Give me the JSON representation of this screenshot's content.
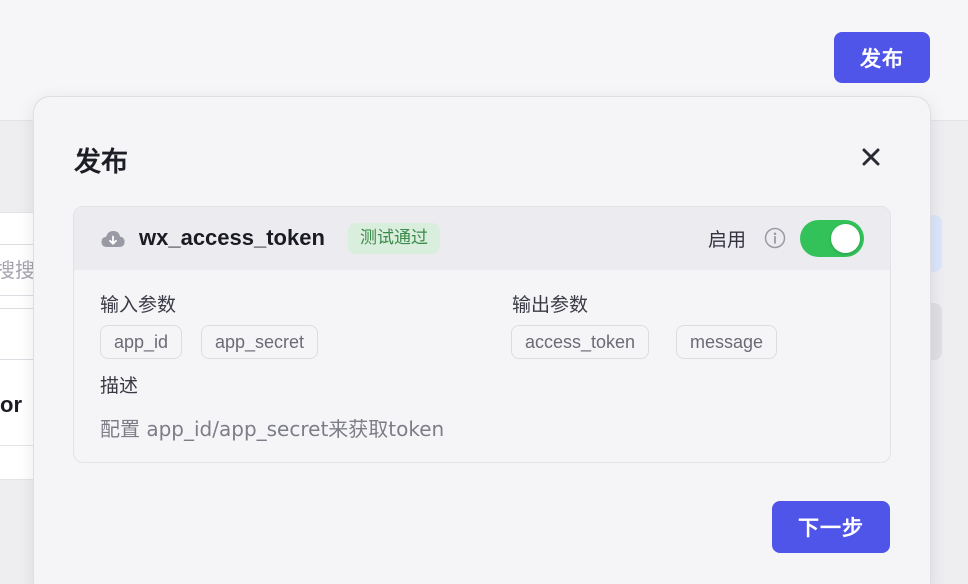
{
  "page": {
    "publish_button": "发布",
    "background_search_placeholder": "搜搜索",
    "background_row_text": "or"
  },
  "dialog": {
    "title": "发布",
    "close_icon": "close-icon",
    "tool": {
      "icon": "cloud-icon",
      "name": "wx_access_token",
      "status": "测试通过",
      "enable_label": "启用",
      "info_icon": "info-icon",
      "enabled": true,
      "input_params_label": "输入参数",
      "input_params": [
        "app_id",
        "app_secret"
      ],
      "output_params_label": "输出参数",
      "output_params": [
        "access_token",
        "message"
      ],
      "description_label": "描述",
      "description": "配置 app_id/app_secret来获取token"
    },
    "next_button": "下一步"
  },
  "colors": {
    "primary": "#4f55e8",
    "toggle_on": "#33c25a",
    "badge_bg": "#d9eedc",
    "badge_text": "#3a8a4b"
  }
}
